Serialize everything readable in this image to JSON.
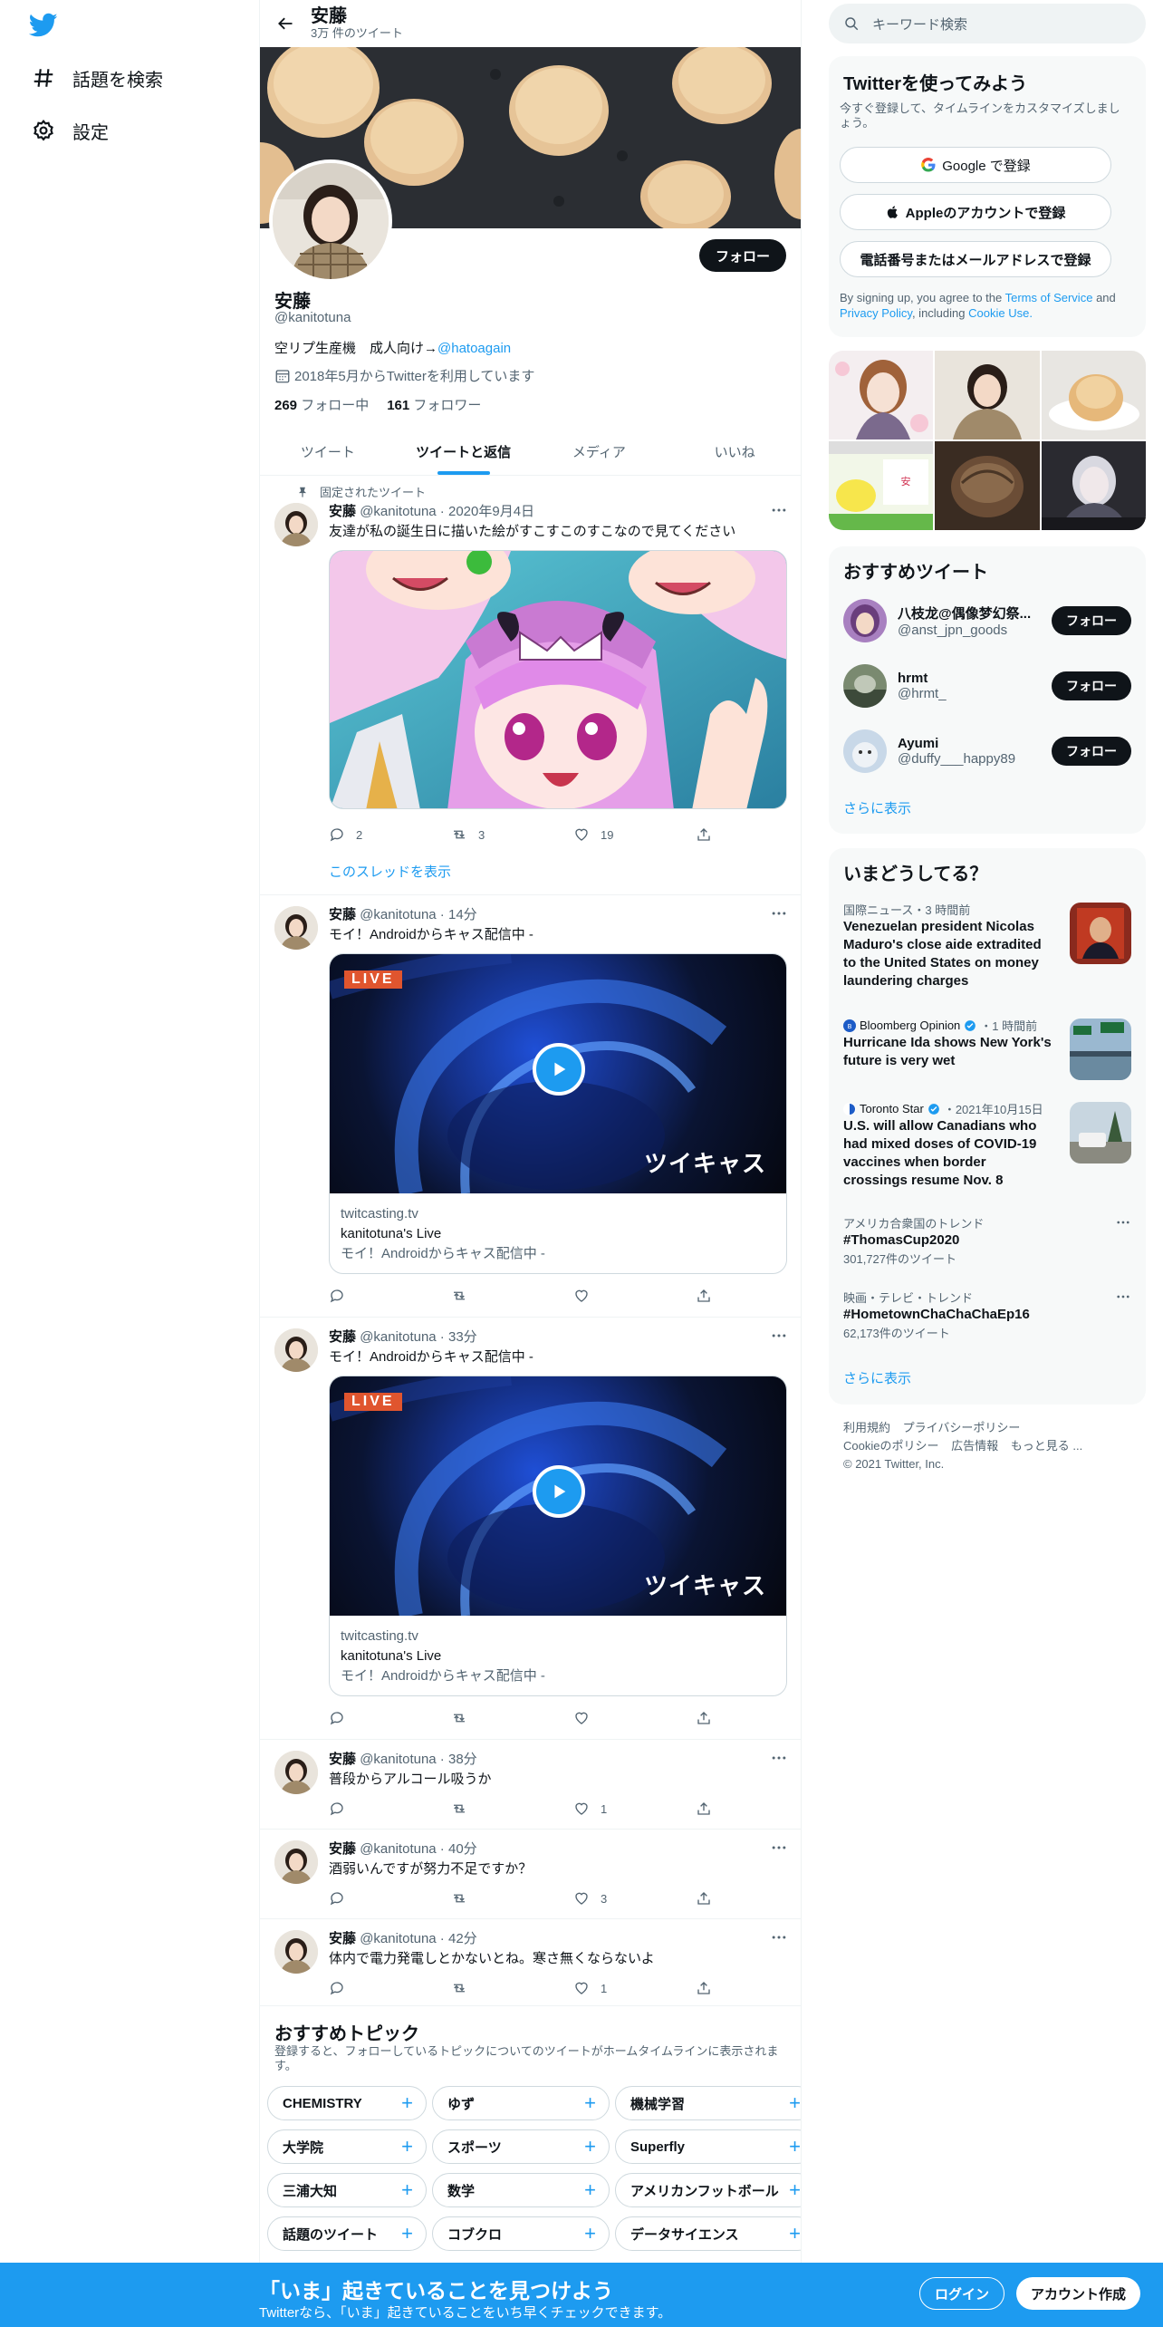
{
  "colors": {
    "accent": "#1d9bf0",
    "text": "#0f1419",
    "muted": "#536471",
    "live_badge": "#e0552e"
  },
  "nav": {
    "items": [
      {
        "icon": "hash-icon",
        "label": "話題を検索"
      },
      {
        "icon": "gear-icon",
        "label": "設定"
      }
    ]
  },
  "header": {
    "name": "安藤",
    "tweet_count": "3万 件のツイート"
  },
  "profile": {
    "name": "安藤",
    "handle": "@kanitotuna",
    "bio_text": "空リプ生産機　成人向け→",
    "bio_link": "@hatoagain",
    "joined": "2018年5月からTwitterを利用しています",
    "following_count": "269",
    "following_label": "フォロー中",
    "followers_count": "161",
    "followers_label": "フォロワー",
    "follow_button": "フォロー"
  },
  "tabs": [
    "ツイート",
    "ツイートと返信",
    "メディア",
    "いいね"
  ],
  "tweets": [
    {
      "pinned_label": "固定されたツイート",
      "name": "安藤",
      "handle": "@kanitotuna",
      "time": "2020年9月4日",
      "text": "友達が私の誕生日に描いた絵がすこすこのすこなので見てください",
      "replies": "2",
      "retweets": "3",
      "likes": "19",
      "show_thread": "このスレッドを表示"
    },
    {
      "name": "安藤",
      "handle": "@kanitotuna",
      "time": "14分",
      "text": "モイ！Androidからキャス配信中 -",
      "card": {
        "badge": "LIVE",
        "logo": "ツイキャス",
        "domain": "twitcasting.tv",
        "title": "kanitotuna's Live",
        "desc": "モイ！Androidからキャス配信中 -"
      }
    },
    {
      "name": "安藤",
      "handle": "@kanitotuna",
      "time": "33分",
      "text": "モイ！Androidからキャス配信中 -",
      "card": {
        "badge": "LIVE",
        "logo": "ツイキャス",
        "domain": "twitcasting.tv",
        "title": "kanitotuna's Live",
        "desc": "モイ！Androidからキャス配信中 -"
      }
    },
    {
      "name": "安藤",
      "handle": "@kanitotuna",
      "time": "38分",
      "text": "普段からアルコール吸うか",
      "likes": "1"
    },
    {
      "name": "安藤",
      "handle": "@kanitotuna",
      "time": "40分",
      "text": "酒弱いんですが努力不足ですか？",
      "likes": "3"
    },
    {
      "name": "安藤",
      "handle": "@kanitotuna",
      "time": "42分",
      "text": "体内で電力発電しとかないとね。寒さ無くならないよ",
      "likes": "1"
    }
  ],
  "topics": {
    "title": "おすすめトピック",
    "subtitle": "登録すると、フォローしているトピックについてのツイートがホームタイムラインに表示されます。",
    "items": [
      "CHEMISTRY",
      "ゆず",
      "機械学習",
      "大学院",
      "スポーツ",
      "Superfly",
      "三浦大知",
      "数学",
      "アメリカンフットボール",
      "話題のツイート",
      "コブクロ",
      "データサイエンス"
    ]
  },
  "right": {
    "search_placeholder": "キーワード検索",
    "signup": {
      "title": "Twitterを使ってみよう",
      "subtitle": "今すぐ登録して、タイムラインをカスタマイズしましょう。",
      "google": "Google で登録",
      "apple": "Appleのアカウントで登録",
      "phone": "電話番号またはメールアドレスで登録",
      "terms_prefix": "By signing up, you agree to the",
      "terms_link": "Terms of Service",
      "terms_and": "and",
      "privacy_link": "Privacy Policy",
      "terms_including": ", including",
      "cookie_link": "Cookie Use."
    },
    "who_to_follow": {
      "title": "おすすめツイート",
      "users": [
        {
          "name": "八枝龙@偶像梦幻祭...",
          "handle": "@anst_jpn_goods"
        },
        {
          "name": "hrmt",
          "handle": "@hrmt_"
        },
        {
          "name": "Ayumi",
          "handle": "@duffy___happy89"
        }
      ],
      "follow_label": "フォロー",
      "show_more": "さらに表示"
    },
    "trends": {
      "title": "いまどうしてる？",
      "items": [
        {
          "meta": "国際ニュース・3 時間前",
          "title": "Venezuelan president Nicolas Maduro's close aide extradited to the United States on money laundering charges"
        },
        {
          "source": "Bloomberg Opinion",
          "time": "・1 時間前",
          "title": "Hurricane Ida shows New York's future is very wet"
        },
        {
          "source": "Toronto Star",
          "time": "・2021年10月15日",
          "title": "U.S. will allow Canadians who had mixed doses of COVID-19 vaccines when border crossings resume Nov. 8"
        },
        {
          "meta": "アメリカ合衆国のトレンド",
          "title": "#ThomasCup2020",
          "count": "301,727件のツイート"
        },
        {
          "meta": "映画・テレビ・トレンド",
          "title": "#HometownChaChaChaEp16",
          "count": "62,173件のツイート"
        }
      ],
      "show_more": "さらに表示"
    },
    "footer": {
      "terms": "利用規約",
      "privacy": "プライバシーポリシー",
      "cookie": "Cookieのポリシー",
      "ads": "広告情報",
      "more": "もっと見る ...",
      "copyright": "© 2021 Twitter, Inc."
    }
  },
  "bottom_bar": {
    "title": "「いま」起きていることを見つけよう",
    "subtitle": "Twitterなら、「いま」起きていることをいち早くチェックできます。",
    "login": "ログイン",
    "signup": "アカウント作成"
  }
}
